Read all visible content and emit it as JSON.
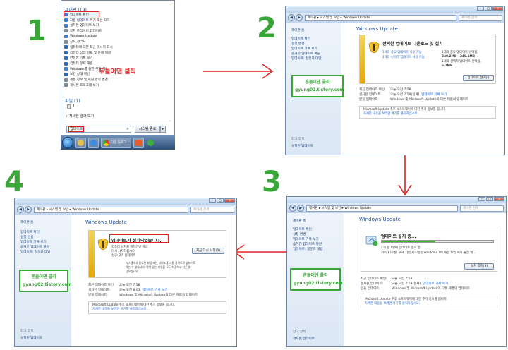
{
  "steps": [
    "1",
    "2",
    "3",
    "4"
  ],
  "start_menu": {
    "group_title": "제어판 (19)",
    "items": [
      "업데이트 확인",
      "자동 업데이트 켜기 또는 끄기",
      "설치된 업데이트 보기",
      "장치 드라이버 업데이트",
      "Windows Update",
      "장치 관리자",
      "컴퓨터에 대한 최근 메시지 표시",
      "컴퓨터 상태 검토 및 문제 해결",
      "안정성 기록 보기",
      "컴퓨터 문제 해결",
      "Windows를 통한 추가 기능...",
      "보안 상태 확인",
      "제품 정보 및 지원 방식 변경",
      "게시된 프로그램 보기"
    ],
    "click_note": "두들어댄 클릭",
    "files_group": "파일 (1)",
    "file_item": "1",
    "more_results": "자세한 결과 보기",
    "search_text": "업데이트",
    "clear_icon": "×",
    "shutdown": "시스템 종료",
    "shutdown_arrow": "▸",
    "taskbar_label": "다음 블로그..."
  },
  "window": {
    "address": "제어판 ▸ 시스템 및 보안 ▸ Windows Update",
    "search_placeholder": "제어판 검색",
    "back": "◀",
    "forward": "▶",
    "minimize": "–",
    "maximize": "□",
    "close": "×",
    "side": {
      "home": "제어판 홈",
      "items": [
        "업데이트 확인",
        "설정 변경",
        "업데이트 기록 보기",
        "숨겨진 업데이트 복원",
        "업데이트: 질문과 대답"
      ],
      "see_also": "참고 항목",
      "installed": "설치된 업데이트"
    },
    "watermark_line1": "흔들어댄 콜라",
    "watermark_line2": "gyung02.tistory.com",
    "wu_title": "Windows Update",
    "info": {
      "recent_label": "최근 업데이트 확인:",
      "recent_value": "오늘 오전 7:58",
      "installed_label": "설치된 업데이트:",
      "installed_value_short": "오늘 오전 7:59(실패).",
      "installed_link": "업데이트 기록 보기",
      "installed_value_done": "오늘 오전 8:03.",
      "receive_label": "받을 업데이트:",
      "receive_value": "Windows 및 Microsoft Update의 다른 제품의 업데이트"
    },
    "ms_note": "Microsoft Update 추후 소프트웨어에 대한 추가 정보를 봅니다.",
    "ms_link": "자세한 내용을 보려면 여기를 클릭하십시오."
  },
  "panel2": {
    "title": "선택한 업데이트 다운로드 및 설치",
    "link1": "1개의 중요 업데이트 사용 가능",
    "link2": "1개의 선택적 업데이트 사용 가능",
    "sel1": "1개의 중요 업데이트 선택됨,",
    "sel1b": "240.2MB - 240.1MB",
    "sel2": "1개의 선택적 업데이트 선택됨,",
    "sel2b": "6.7MB",
    "button": "업데이트 설치(I)"
  },
  "panel3": {
    "title": "업데이트 설치 중...",
    "line1": "2개 중 1번째 업데이트 설치 중...",
    "line2": "2010-12월, x64 기반 시스템용 Windows 7에 대한 보안 패치 롤업 월...",
    "button": "설치 중지(S)"
  },
  "panel4": {
    "title": "업데이트가 설치되었습니다.",
    "line1": "컴퓨터 설치를 마치려면 지금",
    "line2": "다시 시작하십시오.",
    "line3": "성공: 2개 업데이트",
    "line4": "시스템에서 중요한 파일 또는 서비스를 사용 중이므로 업데이트",
    "line5": "하는 수 없습니다. 열어 있는 파일을 모두 저장하고 다른 창",
    "line6": "닫으십시오.",
    "button": "지금 다시 시작(R)"
  },
  "colors": {
    "step_green": "#3aa63a",
    "highlight_red": "#e02020",
    "link_blue": "#1c5ec9"
  }
}
